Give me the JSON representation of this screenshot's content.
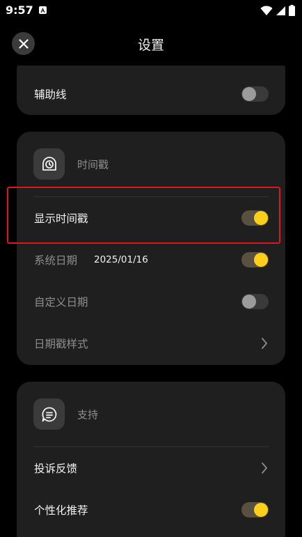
{
  "status_bar": {
    "time": "9:57",
    "icons": [
      "accessibility-a-icon",
      "wifi-icon",
      "cellular-signal-icon",
      "battery-icon"
    ]
  },
  "header": {
    "title": "设置",
    "close_icon": "close-icon"
  },
  "guides_card": {
    "rows": [
      {
        "label": "辅助线",
        "toggle": "off"
      }
    ]
  },
  "timestamp_section": {
    "title": "时间戳",
    "icon": "clock-stamp-icon",
    "rows": [
      {
        "label": "显示时间戳",
        "toggle": "on"
      },
      {
        "label": "系统日期",
        "value": "2025/01/16",
        "toggle": "on"
      },
      {
        "label": "自定义日期",
        "toggle": "off"
      },
      {
        "label": "日期戳样式",
        "control": "chevron-right-icon"
      }
    ]
  },
  "support_section": {
    "title": "支持",
    "icon": "message-icon",
    "rows": [
      {
        "label": "投诉反馈",
        "control": "chevron-right-icon"
      },
      {
        "label": "个性化推荐",
        "toggle": "on"
      }
    ]
  },
  "colors": {
    "background": "#000000",
    "card": "#1f1f1f",
    "toggle_on_knob": "#fccf1a",
    "toggle_off_knob": "#9b9b9b",
    "highlight_box": "#e0161b"
  }
}
